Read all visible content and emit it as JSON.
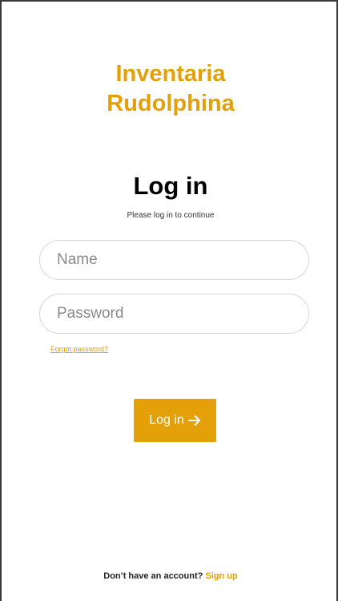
{
  "app": {
    "title_line1": "Inventaria",
    "title_line2": "Rudolphina",
    "accent_color": "#e3a009"
  },
  "login": {
    "heading": "Log in",
    "subheading": "Please log in to continue",
    "name_placeholder": "Name",
    "password_placeholder": "Password",
    "forgot_password": "Forgot password?",
    "submit_label": "Log in",
    "submit_icon": "arrow-right-icon"
  },
  "footer": {
    "prompt": "Don’t have an account?",
    "signup_link": "Sign up"
  }
}
